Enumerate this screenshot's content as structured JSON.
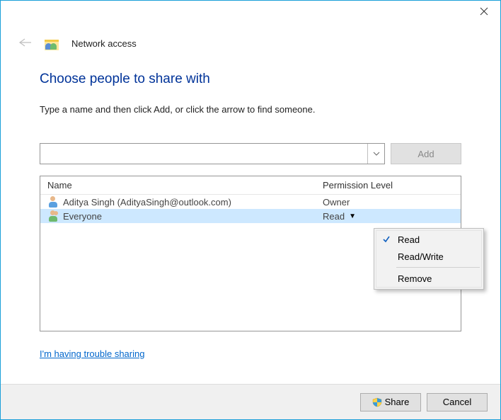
{
  "header": {
    "title": "Network access"
  },
  "main": {
    "heading": "Choose people to share with",
    "instruction": "Type a name and then click Add, or click the arrow to find someone.",
    "name_entry": {
      "value": "",
      "placeholder": ""
    },
    "add_label": "Add",
    "columns": {
      "name": "Name",
      "permission": "Permission Level"
    },
    "rows": [
      {
        "name": "Aditya Singh (AdityaSingh@outlook.com)",
        "permission": "Owner",
        "selected": false
      },
      {
        "name": "Everyone",
        "permission": "Read",
        "selected": true
      }
    ],
    "trouble_link": "I'm having trouble sharing"
  },
  "context_menu": {
    "items": [
      {
        "label": "Read",
        "checked": true
      },
      {
        "label": "Read/Write",
        "checked": false
      }
    ],
    "remove_label": "Remove"
  },
  "footer": {
    "share_label": "Share",
    "cancel_label": "Cancel"
  }
}
